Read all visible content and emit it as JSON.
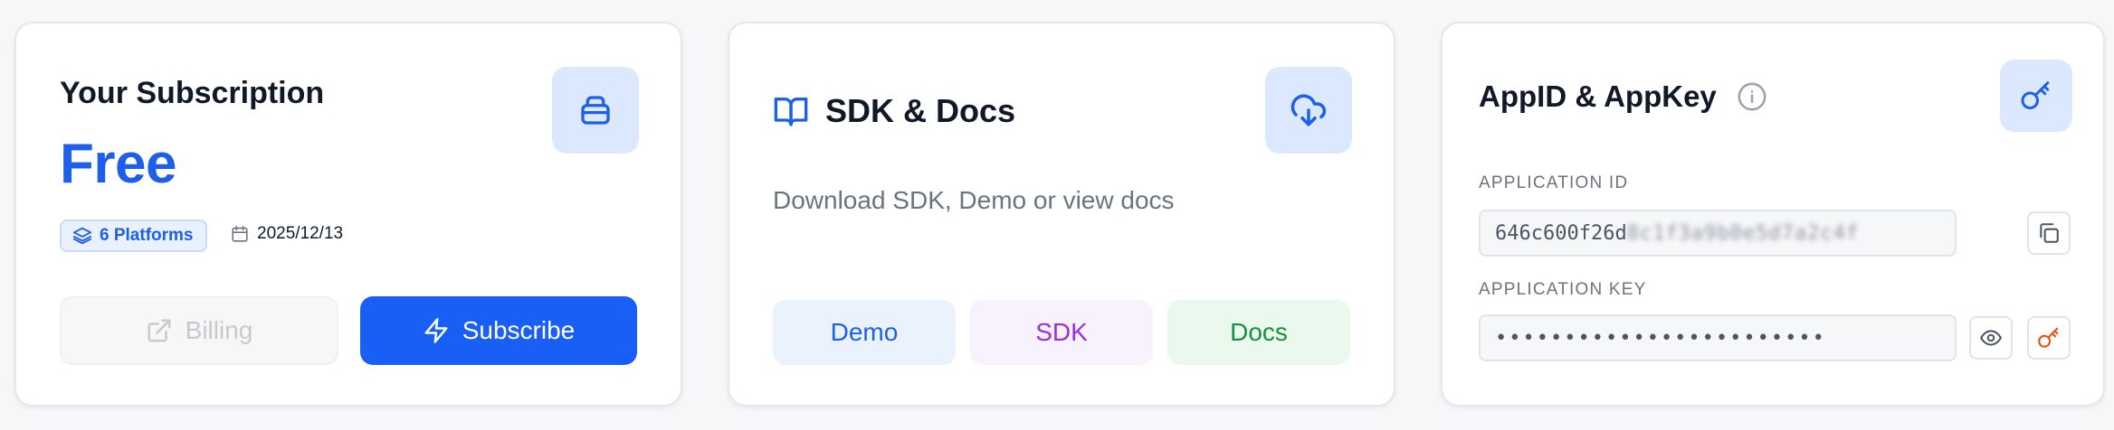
{
  "subscription": {
    "title": "Your Subscription",
    "plan": "Free",
    "platforms_badge": "6 Platforms",
    "date": "2025/12/13",
    "billing_label": "Billing",
    "subscribe_label": "Subscribe",
    "icons": {
      "tile": "package-icon",
      "badge": "layers-icon",
      "date": "calendar-icon",
      "billing": "external-link-icon",
      "subscribe": "zap-icon"
    }
  },
  "sdk": {
    "title": "SDK & Docs",
    "description": "Download SDK, Demo or view docs",
    "buttons": {
      "demo": "Demo",
      "sdk": "SDK",
      "docs": "Docs"
    },
    "icons": {
      "title": "book-open-icon",
      "tile": "cloud-download-icon"
    }
  },
  "app": {
    "title": "AppID & AppKey",
    "app_id_label": "APPLICATION ID",
    "app_id_visible": "646c600f26d",
    "app_id_masked": "8c1f3a9b0e5d7a2c4f",
    "app_key_label": "APPLICATION KEY",
    "app_key_masked": "••••••••••••••••••••••••",
    "icons": {
      "info": "info-icon",
      "tile": "key-icon",
      "copy": "copy-icon",
      "reveal": "eye-icon",
      "regenerate": "key-icon"
    }
  },
  "colors": {
    "accent": "#1a5ff5",
    "tile_bg": "#dbe8fd",
    "sdk_purple": "#9b2fe0",
    "docs_green": "#17913b",
    "key_orange": "#e2571a"
  }
}
